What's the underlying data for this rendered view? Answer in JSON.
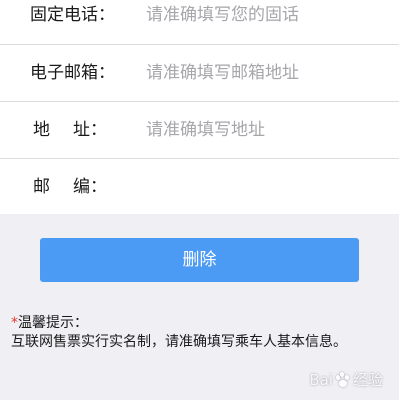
{
  "form": {
    "landline": {
      "label": "固定电话：",
      "value": "",
      "placeholder": "请准确填写您的固话"
    },
    "email": {
      "label": "电子邮箱：",
      "value": "",
      "placeholder": "请准确填写邮箱地址"
    },
    "address": {
      "label_part1": "地",
      "label_part2": "址：",
      "value": "",
      "placeholder": "请准确填写地址"
    },
    "postcode": {
      "label_part1": "邮",
      "label_part2": "编：",
      "value": "",
      "placeholder": ""
    }
  },
  "actions": {
    "delete_label": "删除"
  },
  "tip": {
    "asterisk": "*",
    "title": "温馨提示：",
    "body": "互联网售票实行实名制，请准确填写乘车人基本信息。"
  },
  "watermark": {
    "text_left": "Bai",
    "text_right": "经验"
  },
  "colors": {
    "page_background": "#efeff4",
    "form_background": "#ffffff",
    "button_blue": "#4b9bf5",
    "asterisk_red": "#e8392c",
    "placeholder_gray": "#a6a6ab"
  },
  "icons": {
    "watermark_icon": "paw-icon"
  }
}
